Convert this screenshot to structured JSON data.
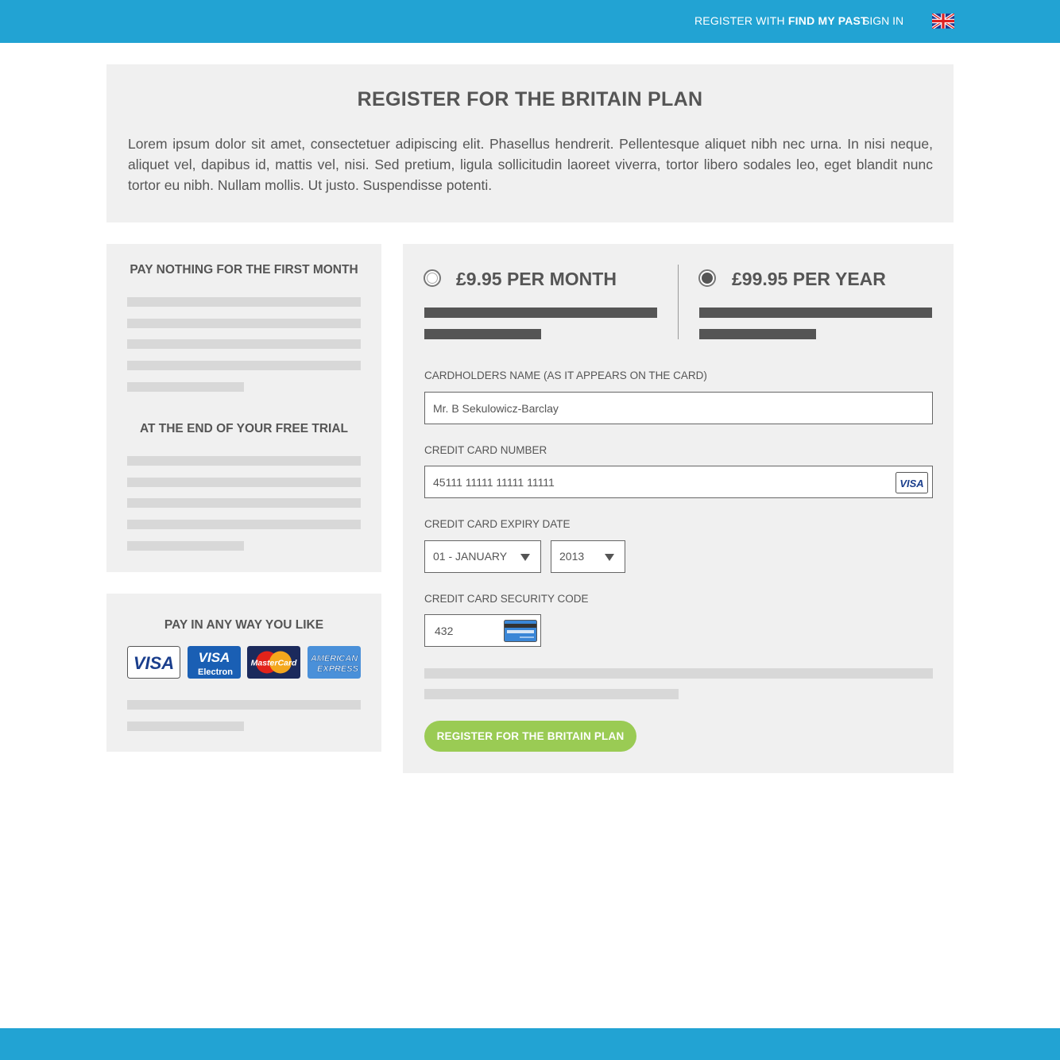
{
  "topbar": {
    "register_prefix": "REGISTER WITH",
    "register_brand": "FIND MY PAST",
    "sign_in": "SIGN IN",
    "flag_icon": "uk-flag-icon"
  },
  "intro": {
    "title": "REGISTER FOR THE BRITAIN PLAN",
    "body": "Lorem ipsum dolor sit amet, consectetuer adipiscing elit. Phasellus hendrerit. Pellentesque aliquet nibh nec urna. In nisi neque, aliquet vel, dapibus id, mattis vel, nisi. Sed pretium, ligula sollicitudin laoreet viverra, tortor libero sodales leo, eget blandit nunc tortor eu nibh. Nullam mollis. Ut justo. Suspendisse potenti."
  },
  "left_panel": {
    "heading1": "PAY NOTHING FOR THE FIRST MONTH",
    "heading2": "AT THE END OF YOUR FREE TRIAL"
  },
  "payment_panel": {
    "heading": "PAY IN ANY WAY YOU LIKE",
    "cards": [
      {
        "name": "visa-card-icon",
        "text": "VISA"
      },
      {
        "name": "visa-electron-card-icon",
        "text": "VISA",
        "sub": "Electron"
      },
      {
        "name": "mastercard-card-icon",
        "text": "MasterCard"
      },
      {
        "name": "american-express-card-icon",
        "text": "AMERICAN",
        "sub": "EXPRESS"
      }
    ]
  },
  "form": {
    "plans": [
      {
        "price": "£9.95 PER MONTH",
        "selected": false
      },
      {
        "price": "£99.95 PER YEAR",
        "selected": true
      }
    ],
    "cardholder_label": "CARDHOLDERS NAME (AS IT APPEARS ON THE CARD)",
    "cardholder_value": "Mr. B Sekulowicz-Barclay",
    "card_number_label": "CREDIT CARD NUMBER",
    "card_number_value": "45111 11111 11111 11111",
    "card_brand_badge": "VISA",
    "expiry_label": "CREDIT CARD EXPIRY DATE",
    "expiry_month": "01 -  JANUARY",
    "expiry_year": "2013",
    "security_label": "CREDIT CARD SECURITY CODE",
    "security_value": "432",
    "submit_label": "REGISTER FOR THE BRITAIN PLAN"
  },
  "colors": {
    "brand_blue": "#22a3d3",
    "panel_grey": "#f0f0f0",
    "button_green": "#9acb54",
    "text_dark": "#555555"
  }
}
